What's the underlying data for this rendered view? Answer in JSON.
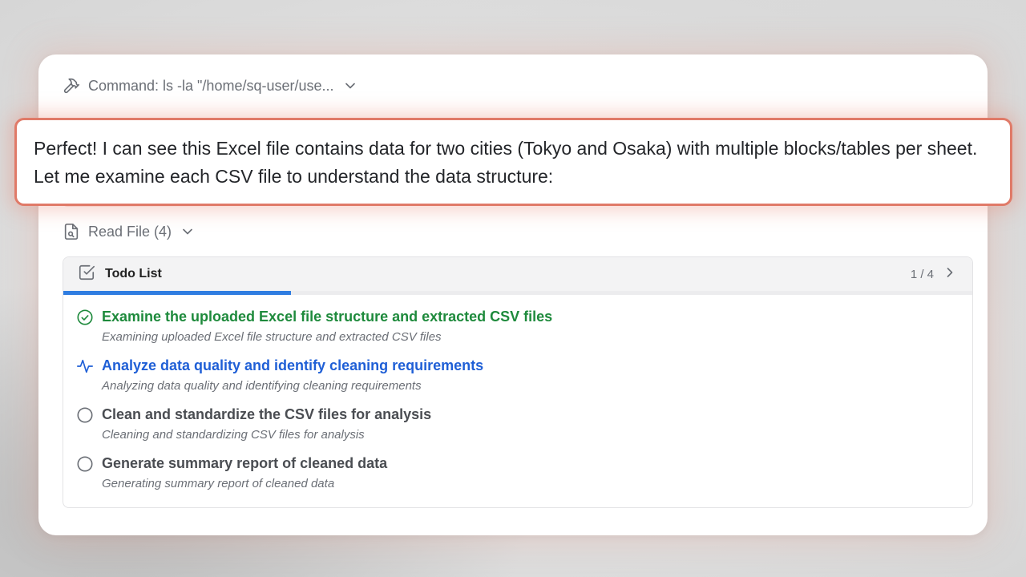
{
  "command": {
    "label": "Command: ls -la \"/home/sq-user/use...",
    "icon": "hammer-icon"
  },
  "read_file": {
    "label": "Read File (4)",
    "icon": "file-search-icon"
  },
  "todo": {
    "title": "Todo List",
    "count": "1 / 4",
    "progress": 0.25,
    "items": [
      {
        "title": "Examine the uploaded Excel file structure and extracted CSV files",
        "subtitle": "Examining uploaded Excel file structure and extracted CSV files",
        "status": "done"
      },
      {
        "title": "Analyze data quality and identify cleaning requirements",
        "subtitle": "Analyzing data quality and identifying cleaning requirements",
        "status": "active"
      },
      {
        "title": "Clean and standardize the CSV files for analysis",
        "subtitle": "Cleaning and standardizing CSV files for analysis",
        "status": "pending"
      },
      {
        "title": "Generate summary report of cleaned data",
        "subtitle": "Generating summary report of cleaned data",
        "status": "pending"
      }
    ]
  },
  "callout": {
    "text": "Perfect! I can see this Excel file contains data for two cities (Tokyo and Osaka) with multiple blocks/tables per sheet. Let me examine each CSV file to understand the data structure:"
  },
  "colors": {
    "done": "#1e8a3c",
    "active": "#1f5fd6",
    "progress": "#2f7de1",
    "callout_border": "#e07a68"
  }
}
